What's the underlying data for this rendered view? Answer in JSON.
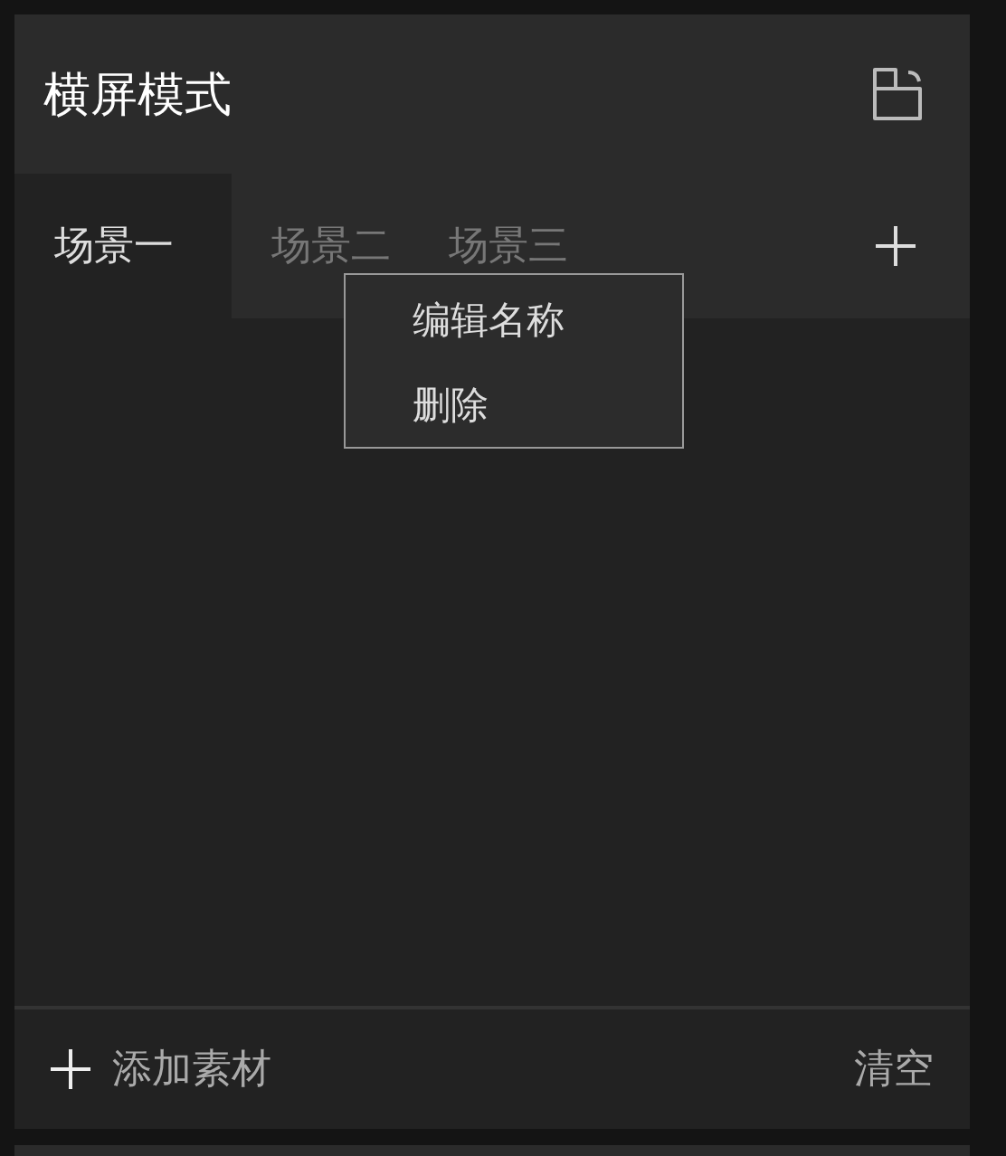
{
  "header": {
    "title": "横屏模式"
  },
  "tabs": [
    {
      "label": "场景一",
      "selected": true
    },
    {
      "label": "场景二",
      "selected": false
    },
    {
      "label": "场景三",
      "selected": false
    }
  ],
  "context_menu": {
    "items": [
      "编辑名称",
      "删除"
    ]
  },
  "footer": {
    "add_label": "添加素材",
    "clear_label": "清空"
  }
}
